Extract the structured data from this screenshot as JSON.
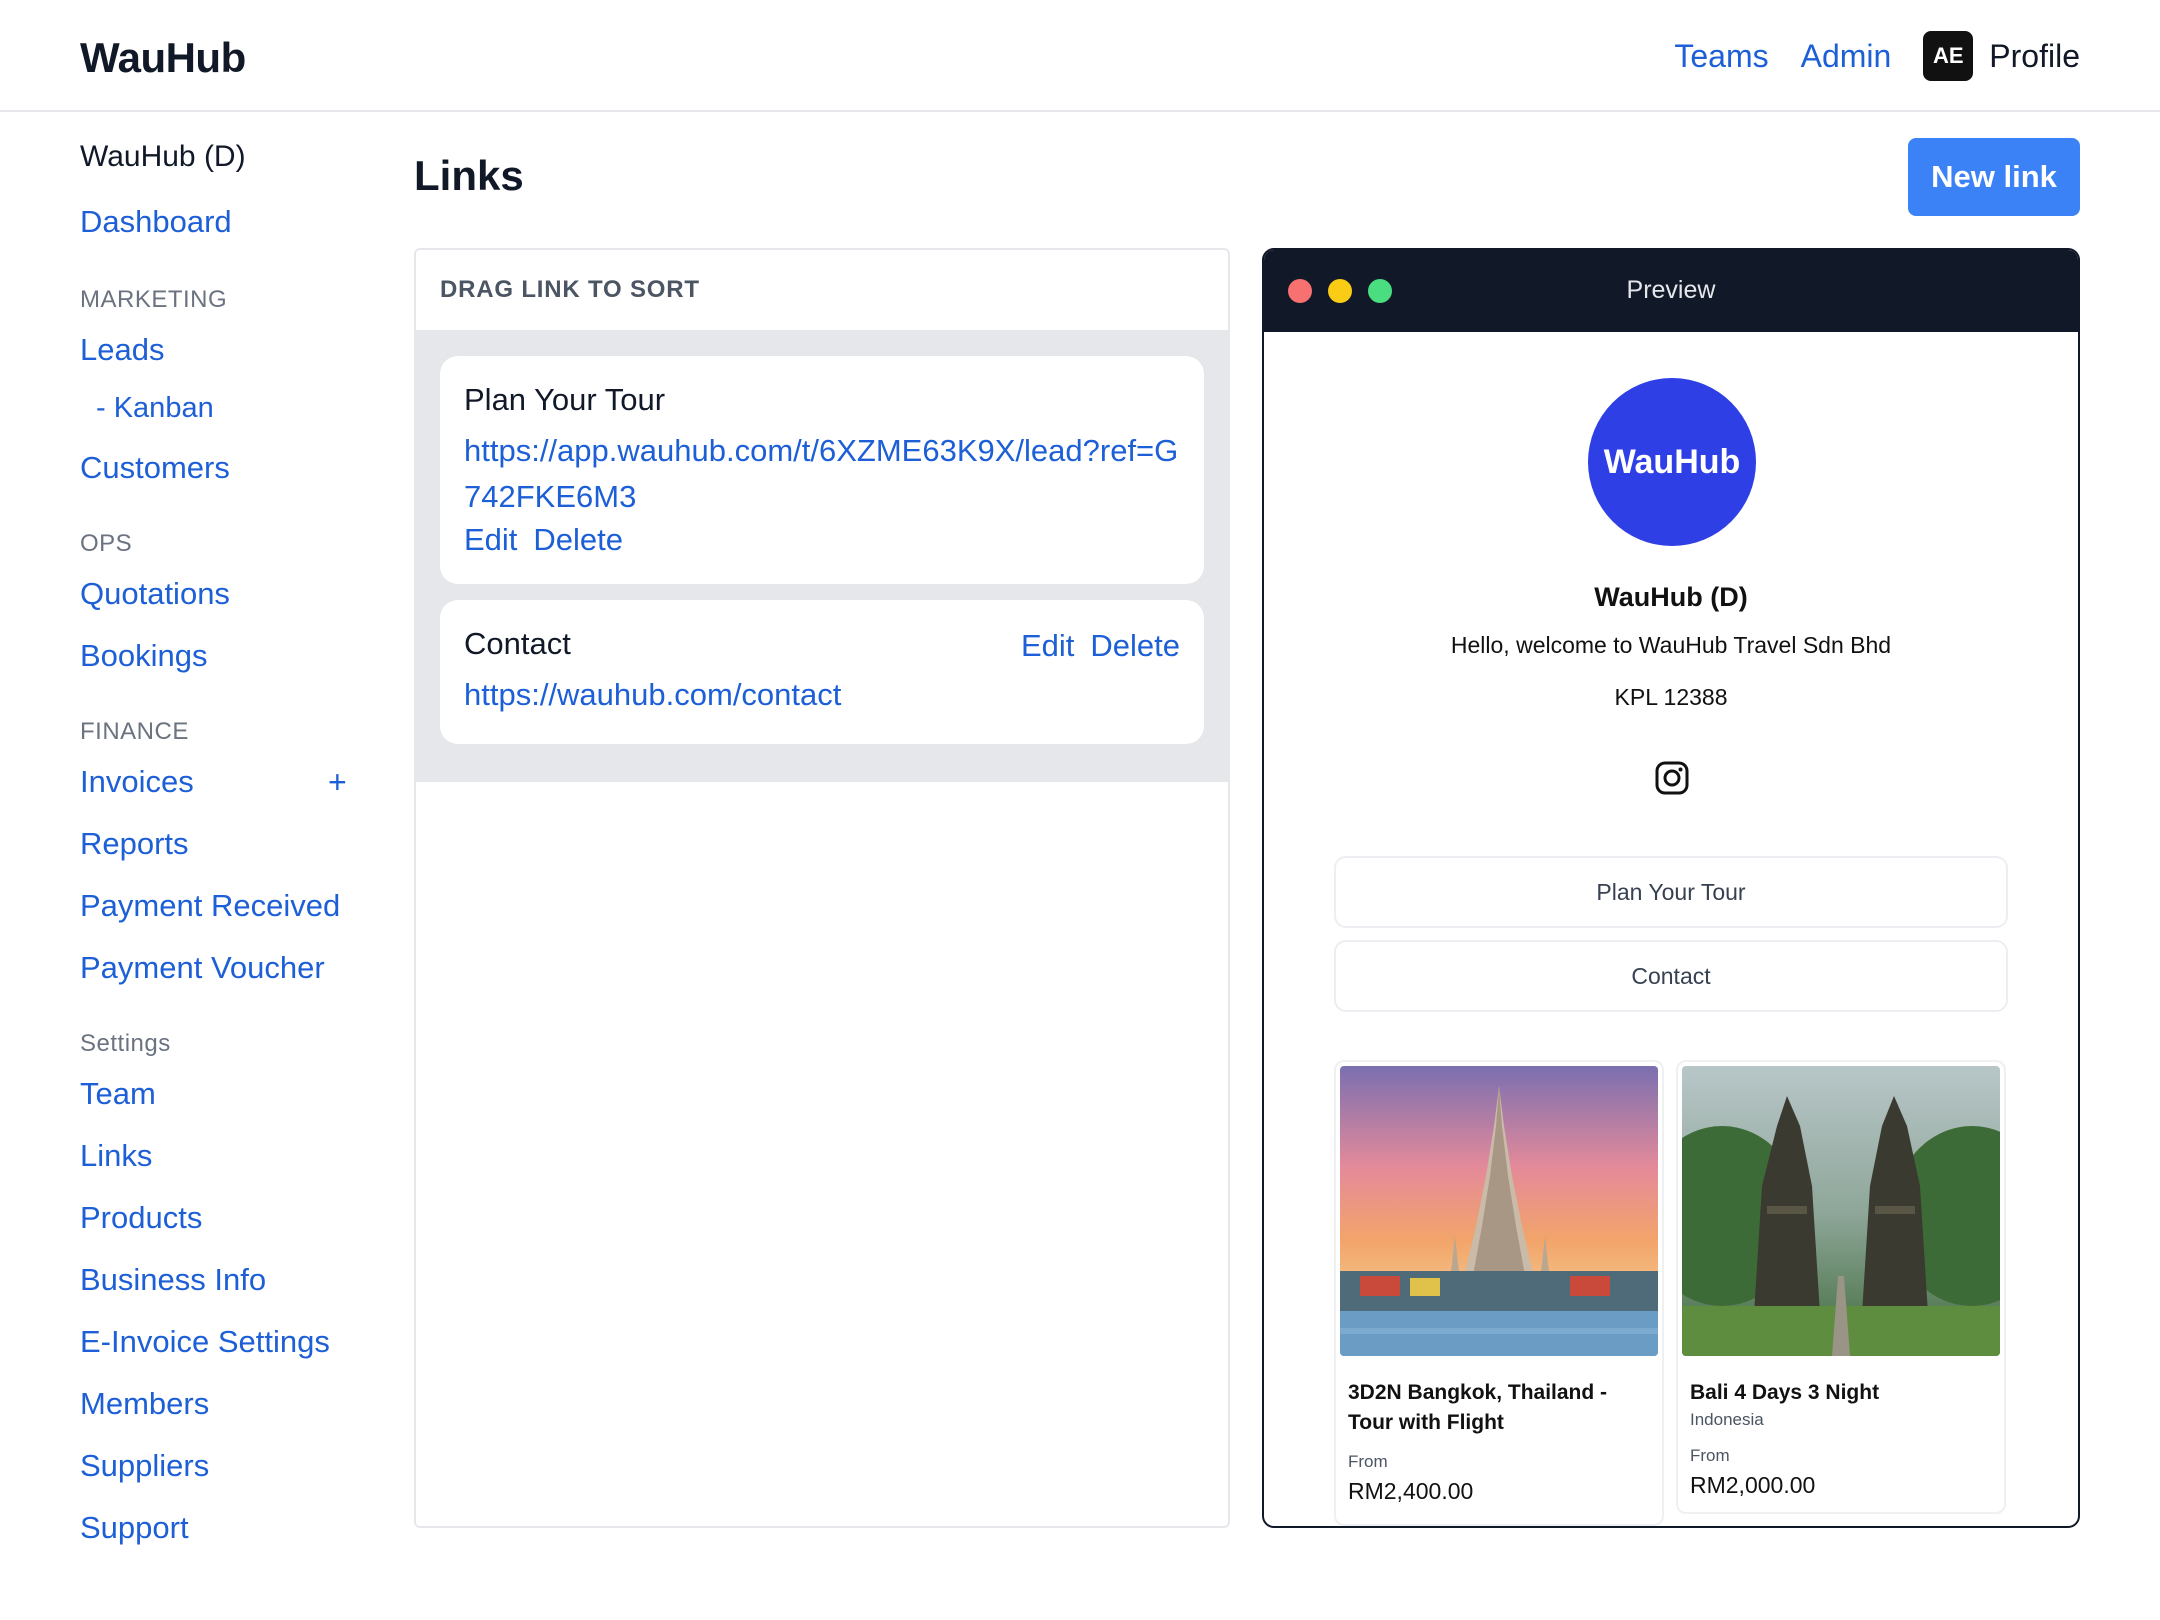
{
  "app": {
    "brand": "WauHub"
  },
  "topnav": {
    "teams": "Teams",
    "admin": "Admin",
    "avatar_initials": "AE",
    "profile": "Profile"
  },
  "sidebar": {
    "org": "WauHub (D)",
    "dashboard": "Dashboard",
    "marketing_heading": "MARKETING",
    "leads": "Leads",
    "kanban": "- Kanban",
    "customers": "Customers",
    "ops_heading": "OPS",
    "quotations": "Quotations",
    "bookings": "Bookings",
    "finance_heading": "FINANCE",
    "invoices": "Invoices",
    "invoices_add": "+",
    "reports": "Reports",
    "payment_received": "Payment Received",
    "payment_voucher": "Payment Voucher",
    "settings_heading": "Settings",
    "team": "Team",
    "links": "Links",
    "products": "Products",
    "business_info": "Business Info",
    "einvoice_settings": "E-Invoice Settings",
    "members": "Members",
    "suppliers": "Suppliers",
    "support": "Support"
  },
  "main": {
    "title": "Links",
    "new_link": "New link",
    "panel_header": "DRAG LINK TO SORT",
    "links": [
      {
        "title": "Plan Your Tour",
        "url": "https://app.wauhub.com/t/6XZME63K9X/lead?ref=G742FKE6M3",
        "edit": "Edit",
        "delete": "Delete"
      },
      {
        "title": "Contact",
        "url": "https://wauhub.com/contact",
        "edit": "Edit",
        "delete": "Delete"
      }
    ]
  },
  "preview": {
    "window_title": "Preview",
    "logo_text": "WauHub",
    "name": "WauHub (D)",
    "welcome": "Hello, welcome to WauHub Travel Sdn Bhd",
    "license": "KPL 12388",
    "social_icon": "instagram-icon",
    "buttons": [
      "Plan Your Tour",
      "Contact"
    ],
    "products": [
      {
        "title": "3D2N Bangkok, Thailand - Tour with Flight",
        "subtitle": "",
        "from_label": "From",
        "price": "RM2,400.00"
      },
      {
        "title": "Bali 4 Days 3 Night",
        "subtitle": "Indonesia",
        "from_label": "From",
        "price": "RM2,000.00"
      }
    ]
  },
  "colors": {
    "link": "#1d5fd6",
    "primary_button": "#3b82f6",
    "preview_bar": "#111827",
    "logo_circle": "#2f3fe6"
  }
}
